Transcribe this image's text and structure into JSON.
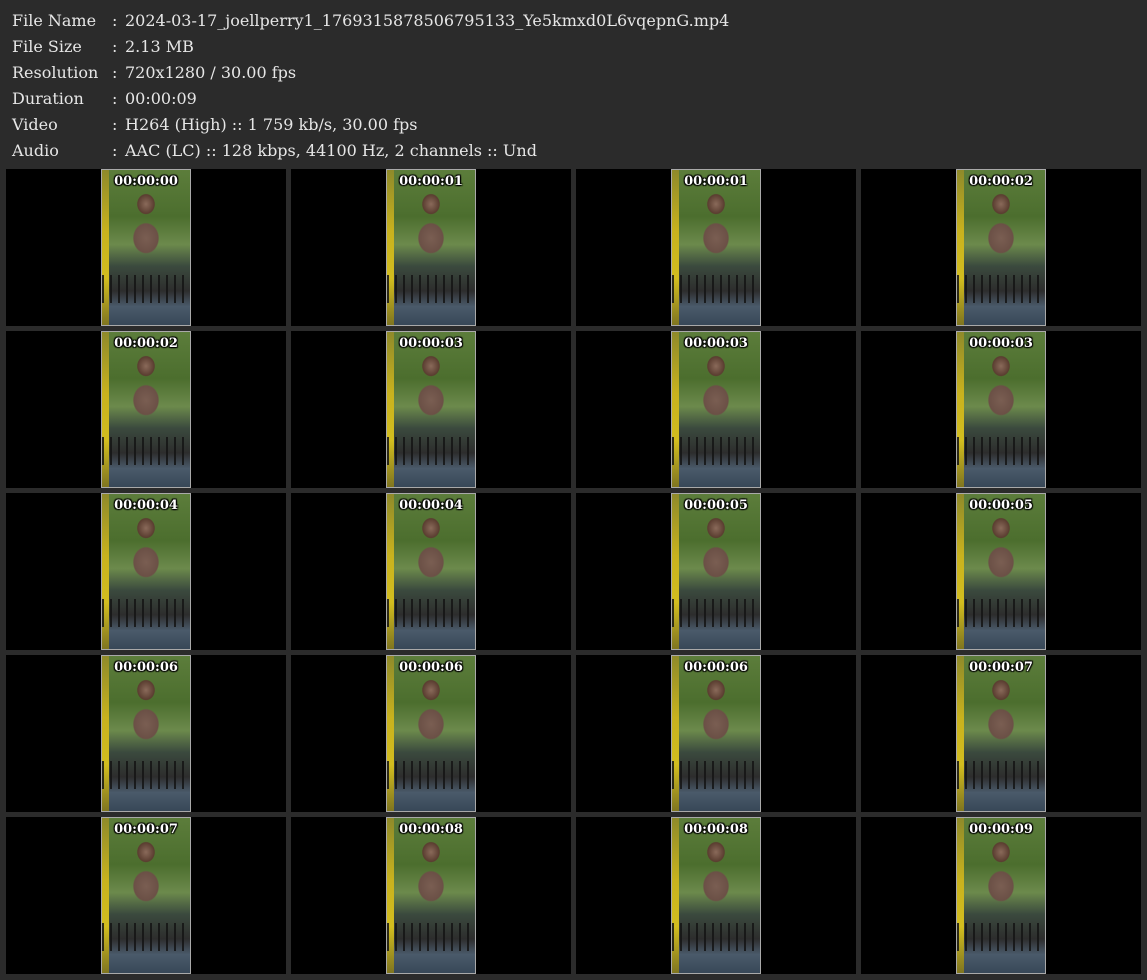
{
  "info": [
    {
      "key": "File Name",
      "sep": ":",
      "value": "2024-03-17_joellperry1_1769315878506795133_Ye5kmxd0L6vqepnG.mp4"
    },
    {
      "key": "File Size",
      "sep": ":",
      "value": "2.13 MB"
    },
    {
      "key": "Resolution",
      "sep": ":",
      "value": "720x1280 / 30.00 fps"
    },
    {
      "key": "Duration",
      "sep": ":",
      "value": "00:00:09"
    },
    {
      "key": "Video",
      "sep": ":",
      "value": "H264 (High) :: 1 759 kb/s, 30.00 fps"
    },
    {
      "key": "Audio",
      "sep": ":",
      "value": "AAC (LC) :: 128 kbps, 44100 Hz, 2 channels :: Und"
    }
  ],
  "thumbnails": [
    "00:00:00",
    "00:00:01",
    "00:00:01",
    "00:00:02",
    "00:00:02",
    "00:00:03",
    "00:00:03",
    "00:00:03",
    "00:00:04",
    "00:00:04",
    "00:00:05",
    "00:00:05",
    "00:00:06",
    "00:00:06",
    "00:00:06",
    "00:00:07",
    "00:00:07",
    "00:00:08",
    "00:00:08",
    "00:00:09"
  ]
}
